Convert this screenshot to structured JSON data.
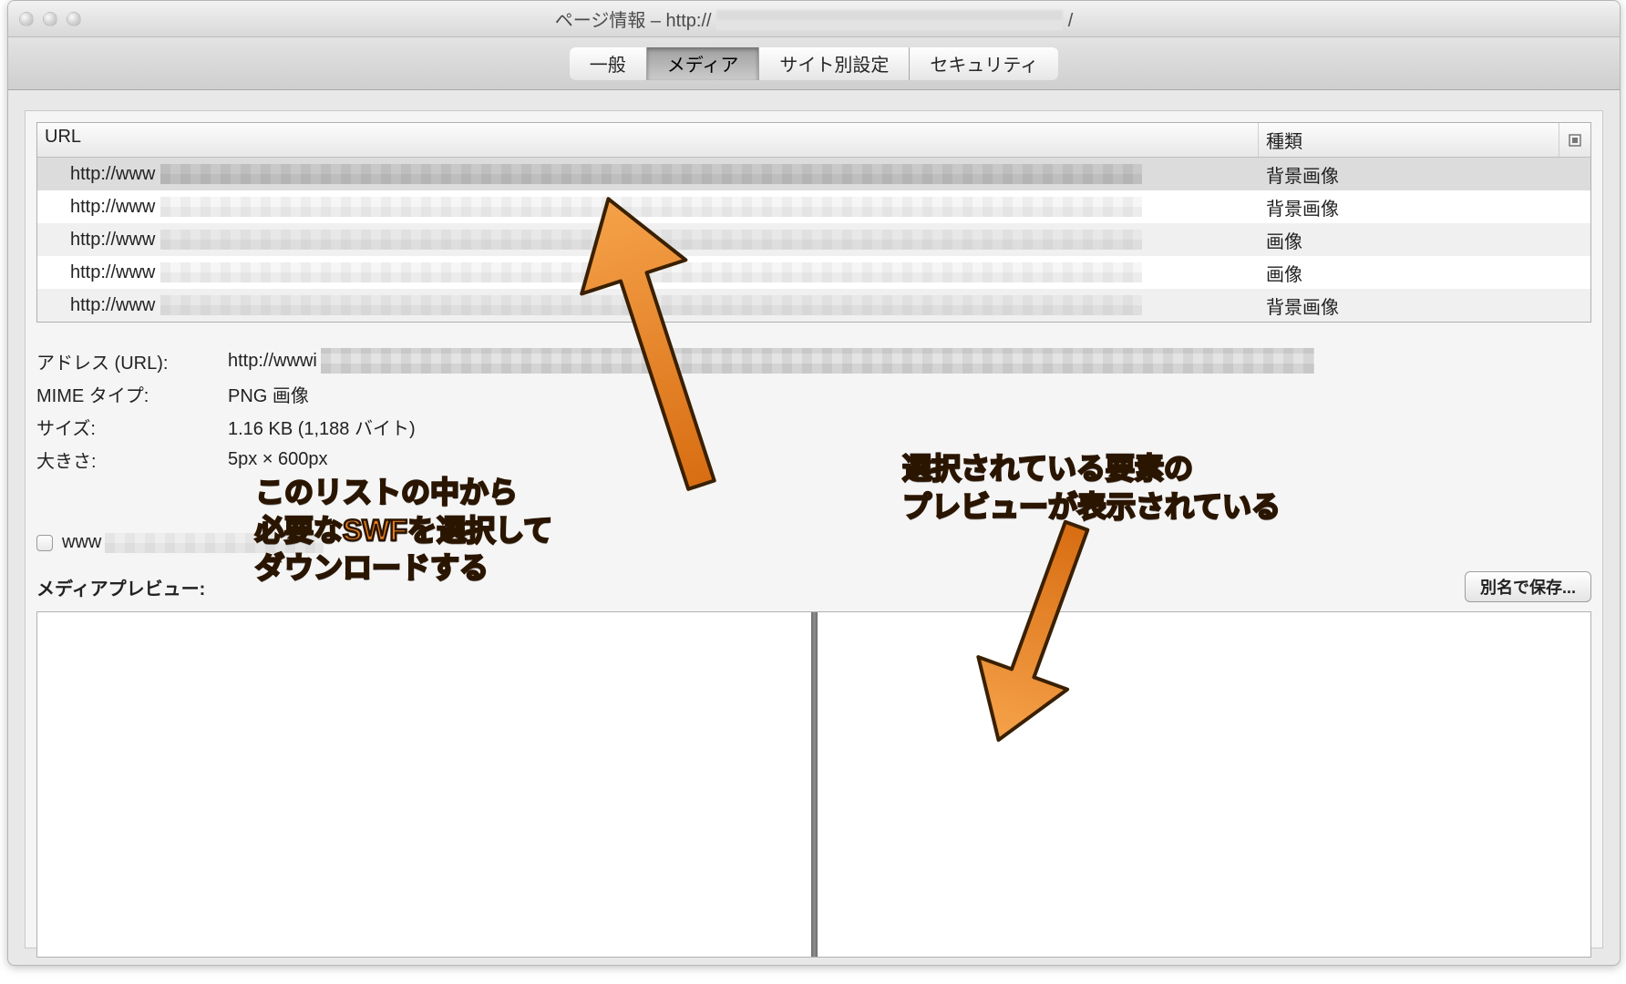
{
  "window": {
    "title_prefix": "ページ情報 – http://"
  },
  "tabs": {
    "general": "一般",
    "media": "メディア",
    "perms": "サイト別設定",
    "security": "セキュリティ"
  },
  "table": {
    "col_url": "URL",
    "col_type": "種類",
    "rows": [
      {
        "url": "http://www",
        "type": "背景画像",
        "selected": true
      },
      {
        "url": "http://www",
        "type": "背景画像",
        "selected": false
      },
      {
        "url": "http://www",
        "type": "画像",
        "selected": false
      },
      {
        "url": "http://www",
        "type": "画像",
        "selected": false
      },
      {
        "url": "http://www",
        "type": "背景画像",
        "selected": false
      }
    ]
  },
  "details": {
    "addr_label": "アドレス (URL):",
    "addr_value": "http://wwwi",
    "mime_label": "MIME タイプ:",
    "mime_value": "PNG 画像",
    "size_label": "サイズ:",
    "size_value": "1.16 KB (1,188 バイト)",
    "dim_label": "大きさ:",
    "dim_value": "5px × 600px"
  },
  "block_checkbox": {
    "prefix": "www"
  },
  "preview": {
    "label": "メディアプレビュー:",
    "saveas": "別名で保存..."
  },
  "annotations": {
    "left": "このリストの中から\n必要なSWFを選択して\nダウンロードする",
    "right": "選択されている要素の\nプレビューが表示されている"
  },
  "colors": {
    "anno_fill": "#e07a1f",
    "anno_stroke": "#2a1500"
  }
}
